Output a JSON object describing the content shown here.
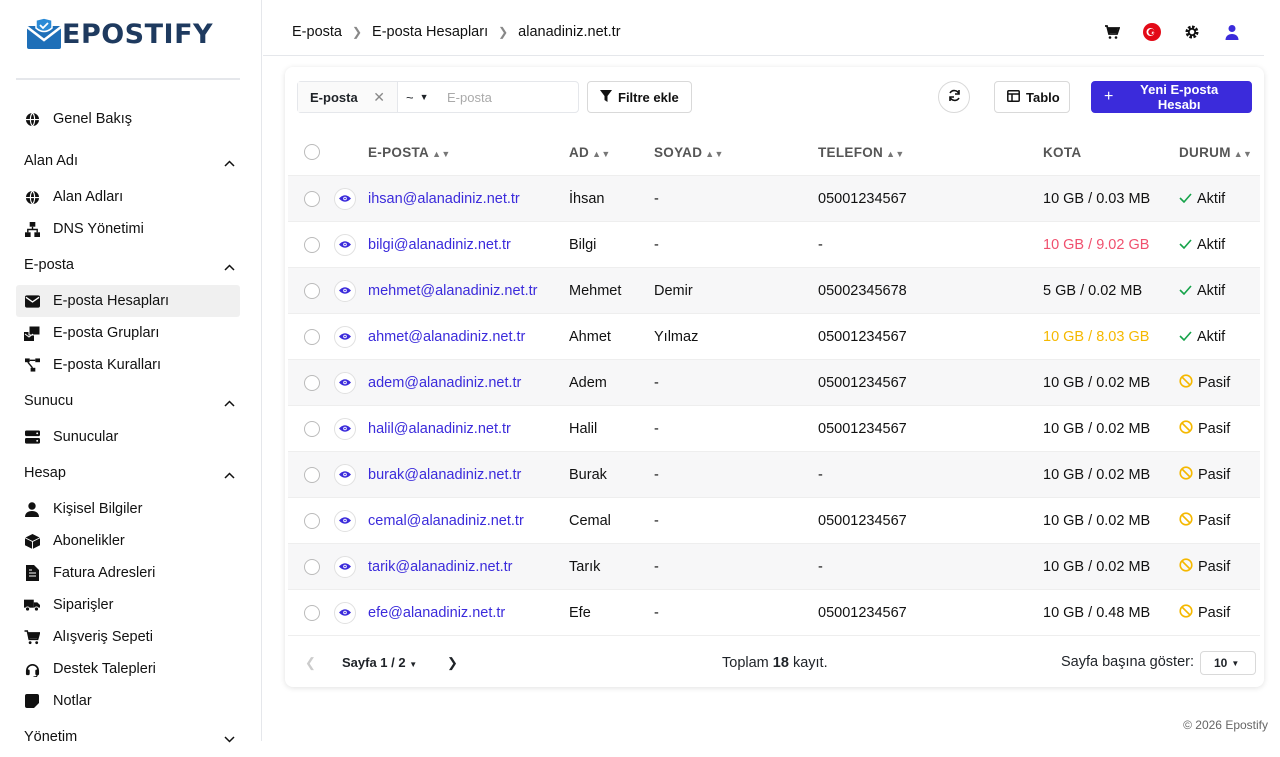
{
  "brand": {
    "name": "EPOSTIFY",
    "primary": "#3b2bdb",
    "logo_color": "#1e3a5f"
  },
  "sidebar": {
    "overview": {
      "label": "Genel Bakış",
      "icon": "globe-icon"
    },
    "groups": [
      {
        "label": "Alan Adı",
        "items": [
          {
            "label": "Alan Adları",
            "icon": "globe-icon"
          },
          {
            "label": "DNS Yönetimi",
            "icon": "sitemap-icon"
          }
        ]
      },
      {
        "label": "E-posta",
        "items": [
          {
            "label": "E-posta Hesapları",
            "icon": "envelope-icon",
            "active": true
          },
          {
            "label": "E-posta Grupları",
            "icon": "mail-bulk-icon"
          },
          {
            "label": "E-posta Kuralları",
            "icon": "flow-icon"
          }
        ]
      },
      {
        "label": "Sunucu",
        "items": [
          {
            "label": "Sunucular",
            "icon": "server-icon"
          }
        ]
      },
      {
        "label": "Hesap",
        "items": [
          {
            "label": "Kişisel Bilgiler",
            "icon": "user-icon"
          },
          {
            "label": "Abonelikler",
            "icon": "box-icon"
          },
          {
            "label": "Fatura Adresleri",
            "icon": "file-icon"
          },
          {
            "label": "Siparişler",
            "icon": "truck-icon"
          },
          {
            "label": "Alışveriş Sepeti",
            "icon": "cart-icon"
          },
          {
            "label": "Destek Talepleri",
            "icon": "headset-icon"
          },
          {
            "label": "Notlar",
            "icon": "note-icon"
          }
        ]
      },
      {
        "label": "Yönetim",
        "items": []
      }
    ]
  },
  "breadcrumb": [
    "E-posta",
    "E-posta Hesapları",
    "alanadiniz.net.tr"
  ],
  "toolbar": {
    "filter_field": "E-posta",
    "filter_op": "~",
    "filter_placeholder": "E-posta",
    "add_filter": "Filtre ekle",
    "table_view": "Tablo",
    "new_account": "Yeni E-posta Hesabı"
  },
  "table": {
    "columns": [
      "E-POSTA",
      "AD",
      "SOYAD",
      "TELEFON",
      "KOTA",
      "DURUM"
    ],
    "rows": [
      {
        "email": "ihsan@alanadiniz.net.tr",
        "name": "İhsan",
        "surname": "-",
        "phone": "05001234567",
        "quota": "10 GB / 0.03 MB",
        "quota_color": "#111111",
        "status": "Aktif"
      },
      {
        "email": "bilgi@alanadiniz.net.tr",
        "name": "Bilgi",
        "surname": "-",
        "phone": "-",
        "quota": "10 GB / 9.02 GB",
        "quota_color": "#f0506e",
        "status": "Aktif"
      },
      {
        "email": "mehmet@alanadiniz.net.tr",
        "name": "Mehmet",
        "surname": "Demir",
        "phone": "05002345678",
        "quota": "5 GB / 0.02 MB",
        "quota_color": "#111111",
        "status": "Aktif"
      },
      {
        "email": "ahmet@alanadiniz.net.tr",
        "name": "Ahmet",
        "surname": "Yılmaz",
        "phone": "05001234567",
        "quota": "10 GB / 8.03 GB",
        "quota_color": "#f5b800",
        "status": "Aktif"
      },
      {
        "email": "adem@alanadiniz.net.tr",
        "name": "Adem",
        "surname": "-",
        "phone": "05001234567",
        "quota": "10 GB / 0.02 MB",
        "quota_color": "#111111",
        "status": "Pasif"
      },
      {
        "email": "halil@alanadiniz.net.tr",
        "name": "Halil",
        "surname": "-",
        "phone": "05001234567",
        "quota": "10 GB / 0.02 MB",
        "quota_color": "#111111",
        "status": "Pasif"
      },
      {
        "email": "burak@alanadiniz.net.tr",
        "name": "Burak",
        "surname": "-",
        "phone": "-",
        "quota": "10 GB / 0.02 MB",
        "quota_color": "#111111",
        "status": "Pasif"
      },
      {
        "email": "cemal@alanadiniz.net.tr",
        "name": "Cemal",
        "surname": "-",
        "phone": "05001234567",
        "quota": "10 GB / 0.02 MB",
        "quota_color": "#111111",
        "status": "Pasif"
      },
      {
        "email": "tarik@alanadiniz.net.tr",
        "name": "Tarık",
        "surname": "-",
        "phone": "-",
        "quota": "10 GB / 0.02 MB",
        "quota_color": "#111111",
        "status": "Pasif"
      },
      {
        "email": "efe@alanadiniz.net.tr",
        "name": "Efe",
        "surname": "-",
        "phone": "05001234567",
        "quota": "10 GB / 0.48 MB",
        "quota_color": "#111111",
        "status": "Pasif"
      }
    ]
  },
  "pagination": {
    "page_label": "Sayfa 1 / 2",
    "total_prefix": "Toplam",
    "total_count": "18",
    "total_suffix": "kayıt.",
    "per_page_label": "Sayfa başına göster:",
    "per_page": "10"
  },
  "footer": "© 2026 Epostify",
  "colors": {
    "active_green": "#16a34a",
    "passive_yellow": "#f5b800"
  }
}
